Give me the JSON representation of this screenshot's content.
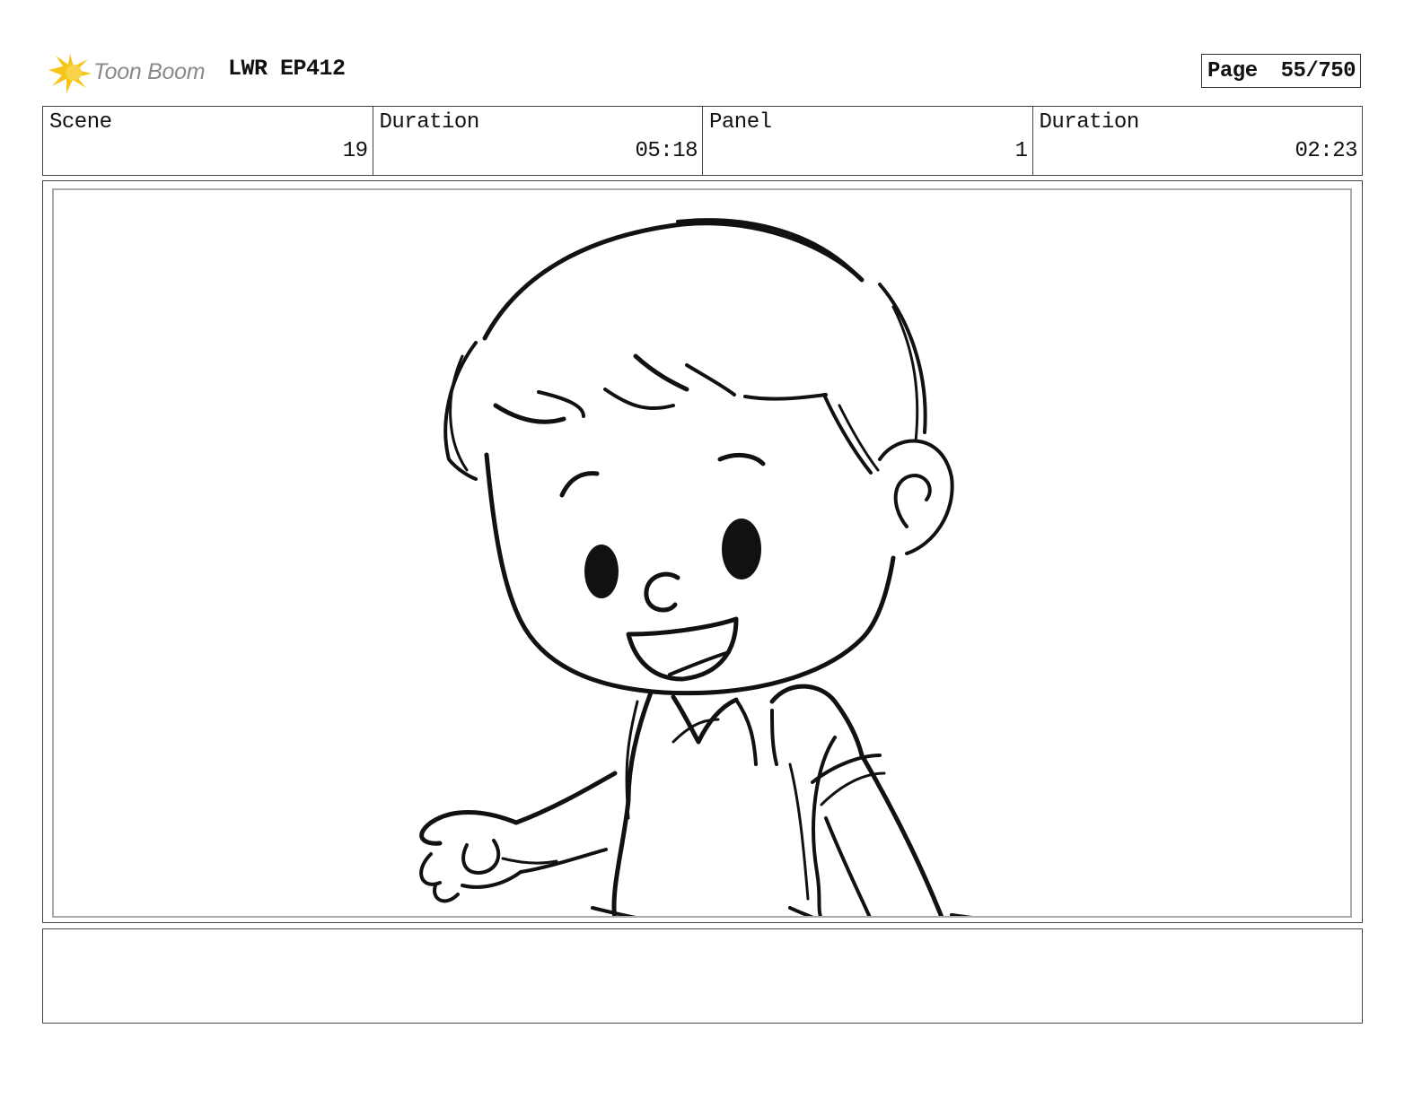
{
  "header": {
    "logo_text": "Toon Boom",
    "project_title": "LWR EP412",
    "page_label": "Page",
    "page_value": "55/750"
  },
  "info": {
    "scene_label": "Scene",
    "scene_value": "19",
    "scene_duration_label": "Duration",
    "scene_duration_value": "05:18",
    "panel_label": "Panel",
    "panel_value": "1",
    "panel_duration_label": "Duration",
    "panel_duration_value": "02:23"
  },
  "colors": {
    "logo_star": "#F5C518",
    "logo_text": "#8a8a8a",
    "ink": "#111111"
  },
  "notes": {
    "text": ""
  }
}
